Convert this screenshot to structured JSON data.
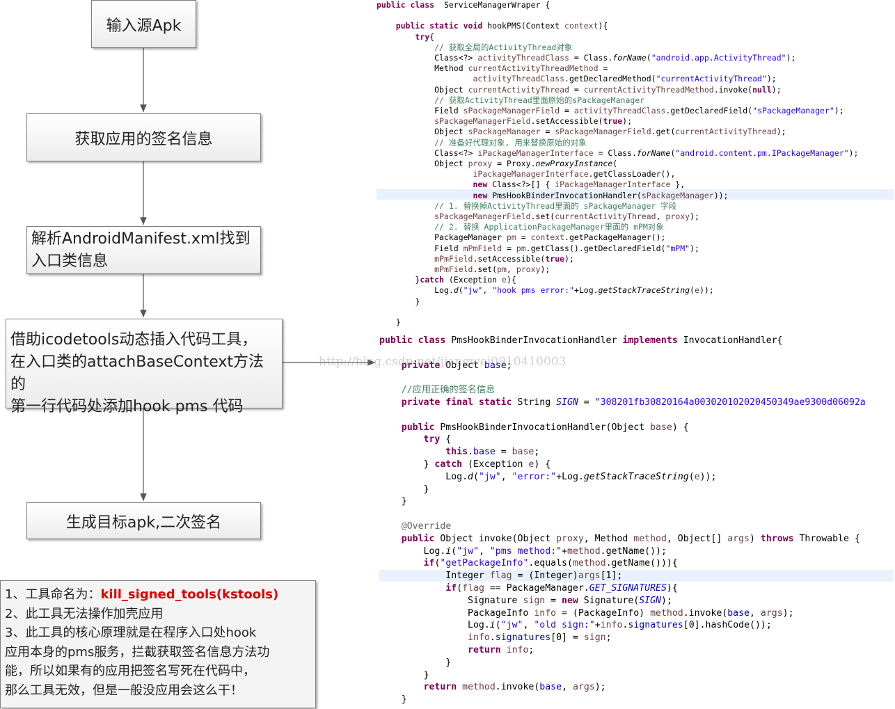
{
  "flow": {
    "step1": "输入源Apk",
    "step2": "获取应用的签名信息",
    "step3": [
      "解析AndroidManifest.xml找到",
      "入口类信息"
    ],
    "step4": [
      "借助icodetools动态插入代码工具，",
      "在入口类的attachBaseContext方法的",
      "第一行代码处添加hook pms 代码"
    ],
    "step5": "生成目标apk,二次签名"
  },
  "notes": {
    "line1_prefix": "1、工具命名为：",
    "line1_name": "kill_signed_tools(kstools)",
    "line2": "2、此工具无法操作加壳应用",
    "line3": "3、此工具的核心原理就是在程序入口处hook",
    "line4": "应用本身的pms服务，拦截获取签名信息方法功",
    "line5": "能，所以如果有的应用把签名写死在代码中，",
    "line6": "那么工具无效，但是一般没应用会这么干！"
  },
  "watermark": "http://blog.csdn.net/jiangwei0910410003",
  "code1": [
    [
      [
        "kw",
        "public class"
      ],
      [
        "",
        "  ServiceManagerWraper {"
      ]
    ],
    [],
    [
      [
        "",
        "    "
      ],
      [
        "kw",
        "public static void"
      ],
      [
        "",
        " hookPMS(Context "
      ],
      [
        "var",
        "context"
      ],
      [
        "",
        "){"
      ]
    ],
    [
      [
        "",
        "        "
      ],
      [
        "kw",
        "try"
      ],
      [
        "",
        "{"
      ]
    ],
    [
      [
        "",
        "            "
      ],
      [
        "cm",
        "// 获取全局的ActivityThread对象"
      ]
    ],
    [
      [
        "",
        "            Class<?> "
      ],
      [
        "var",
        "activityThreadClass"
      ],
      [
        "",
        " = Class."
      ],
      [
        "it",
        "forName"
      ],
      [
        "",
        "("
      ],
      [
        "str",
        "\"android.app.ActivityThread\""
      ],
      [
        "",
        ");"
      ]
    ],
    [
      [
        "",
        "            Method "
      ],
      [
        "var",
        "currentActivityThreadMethod"
      ],
      [
        "",
        " ="
      ]
    ],
    [
      [
        "",
        "                    "
      ],
      [
        "var",
        "activityThreadClass"
      ],
      [
        "",
        ".getDeclaredMethod("
      ],
      [
        "str",
        "\"currentActivityThread\""
      ],
      [
        "",
        ");"
      ]
    ],
    [
      [
        "",
        "            Object "
      ],
      [
        "var",
        "currentActivityThread"
      ],
      [
        "",
        " = "
      ],
      [
        "var",
        "currentActivityThreadMethod"
      ],
      [
        "",
        ".invoke("
      ],
      [
        "kw",
        "null"
      ],
      [
        "",
        ");"
      ]
    ],
    [
      [
        "",
        "            "
      ],
      [
        "cm",
        "// 获取ActivityThread里面原始的sPackageManager"
      ]
    ],
    [
      [
        "",
        "            Field "
      ],
      [
        "var",
        "sPackageManagerField"
      ],
      [
        "",
        " = "
      ],
      [
        "var",
        "activityThreadClass"
      ],
      [
        "",
        ".getDeclaredField("
      ],
      [
        "str",
        "\"sPackageManager\""
      ],
      [
        "",
        ");"
      ]
    ],
    [
      [
        "",
        "            "
      ],
      [
        "var",
        "sPackageManagerField"
      ],
      [
        "",
        ".setAccessible("
      ],
      [
        "kw",
        "true"
      ],
      [
        "",
        ");"
      ]
    ],
    [
      [
        "",
        "            Object "
      ],
      [
        "var",
        "sPackageManager"
      ],
      [
        "",
        " = "
      ],
      [
        "var",
        "sPackageManagerField"
      ],
      [
        "",
        ".get("
      ],
      [
        "var",
        "currentActivityThread"
      ],
      [
        "",
        ");"
      ]
    ],
    [
      [
        "",
        "            "
      ],
      [
        "cm",
        "// 准备好代理对象, 用来替换原始的对象"
      ]
    ],
    [
      [
        "",
        "            Class<?> "
      ],
      [
        "var",
        "iPackageManagerInterface"
      ],
      [
        "",
        " = Class."
      ],
      [
        "it",
        "forName"
      ],
      [
        "",
        "("
      ],
      [
        "str",
        "\"android.content.pm.IPackageManager\""
      ],
      [
        "",
        ");"
      ]
    ],
    [
      [
        "",
        "            Object "
      ],
      [
        "var",
        "proxy"
      ],
      [
        "",
        " = Proxy."
      ],
      [
        "it",
        "newProxyInstance"
      ],
      [
        "",
        "("
      ]
    ],
    [
      [
        "",
        "                    "
      ],
      [
        "var",
        "iPackageManagerInterface"
      ],
      [
        "",
        ".getClassLoader(),"
      ]
    ],
    [
      [
        "",
        "                    "
      ],
      [
        "kw",
        "new"
      ],
      [
        "",
        " Class<?>[] { "
      ],
      [
        "var",
        "iPackageManagerInterface"
      ],
      [
        "",
        " },"
      ]
    ],
    [
      [
        "",
        "                    "
      ],
      [
        "kw",
        "new"
      ],
      [
        "",
        " PmsHookBinderInvocationHandler("
      ],
      [
        "var",
        "sPackageManager"
      ],
      [
        "",
        "));"
      ]
    ],
    [
      [
        "",
        "            "
      ],
      [
        "cm",
        "// 1. 替换掉ActivityThread里面的 sPackageManager 字段"
      ]
    ],
    [
      [
        "",
        "            "
      ],
      [
        "var",
        "sPackageManagerField"
      ],
      [
        "",
        ".set("
      ],
      [
        "var",
        "currentActivityThread"
      ],
      [
        "",
        ", "
      ],
      [
        "var",
        "proxy"
      ],
      [
        "",
        ");"
      ]
    ],
    [
      [
        "",
        "            "
      ],
      [
        "cm",
        "// 2. 替换 ApplicationPackageManager里面的 mPM对象"
      ]
    ],
    [
      [
        "",
        "            PackageManager "
      ],
      [
        "var",
        "pm"
      ],
      [
        "",
        " = "
      ],
      [
        "var",
        "context"
      ],
      [
        "",
        ".getPackageManager();"
      ]
    ],
    [
      [
        "",
        "            Field "
      ],
      [
        "var",
        "mPmField"
      ],
      [
        "",
        " = "
      ],
      [
        "var",
        "pm"
      ],
      [
        "",
        ".getClass().getDeclaredField("
      ],
      [
        "str",
        "\"mPM\""
      ],
      [
        "",
        ");"
      ]
    ],
    [
      [
        "",
        "            "
      ],
      [
        "var",
        "mPmField"
      ],
      [
        "",
        ".setAccessible("
      ],
      [
        "kw",
        "true"
      ],
      [
        "",
        ");"
      ]
    ],
    [
      [
        "",
        "            "
      ],
      [
        "var",
        "mPmField"
      ],
      [
        "",
        ".set("
      ],
      [
        "var",
        "pm"
      ],
      [
        "",
        ", "
      ],
      [
        "var",
        "proxy"
      ],
      [
        "",
        ");"
      ]
    ],
    [
      [
        "",
        "        }"
      ],
      [
        "kw",
        "catch"
      ],
      [
        "",
        " (Exception "
      ],
      [
        "var",
        "e"
      ],
      [
        "",
        "){"
      ]
    ],
    [
      [
        "",
        "            Log."
      ],
      [
        "it",
        "d"
      ],
      [
        "",
        "("
      ],
      [
        "str",
        "\"jw\""
      ],
      [
        "",
        ", "
      ],
      [
        "str",
        "\"hook pms error:\""
      ],
      [
        "",
        "+Log."
      ],
      [
        "it",
        "getStackTraceString"
      ],
      [
        "",
        "("
      ],
      [
        "var",
        "e"
      ],
      [
        "",
        "));"
      ]
    ],
    [
      [
        "",
        "        }"
      ]
    ],
    [],
    [
      [
        "",
        "    }"
      ]
    ]
  ],
  "code2": [
    [
      [
        "kw",
        "public class"
      ],
      [
        "",
        " PmsHookBinderInvocationHandler "
      ],
      [
        "kw",
        "implements"
      ],
      [
        "",
        " InvocationHandler{"
      ]
    ],
    [],
    [
      [
        "",
        "    "
      ],
      [
        "kw",
        "private"
      ],
      [
        "",
        " Object "
      ],
      [
        "fld",
        "base"
      ],
      [
        "",
        ";"
      ]
    ],
    [],
    [
      [
        "",
        "    "
      ],
      [
        "cm",
        "//应用正确的签名信息"
      ]
    ],
    [
      [
        "",
        "    "
      ],
      [
        "kw",
        "private final static"
      ],
      [
        "",
        " String "
      ],
      [
        "fld it",
        "SIGN"
      ],
      [
        "",
        " = "
      ],
      [
        "str",
        "\"308201fb30820164a003020102020450349ae9300d06092a"
      ]
    ],
    [],
    [
      [
        "",
        "    "
      ],
      [
        "kw",
        "public"
      ],
      [
        "",
        " PmsHookBinderInvocationHandler(Object "
      ],
      [
        "var",
        "base"
      ],
      [
        "",
        ") {"
      ]
    ],
    [
      [
        "",
        "        "
      ],
      [
        "kw",
        "try"
      ],
      [
        "",
        " {"
      ]
    ],
    [
      [
        "",
        "            "
      ],
      [
        "kw",
        "this"
      ],
      [
        "",
        "."
      ],
      [
        "fld",
        "base"
      ],
      [
        "",
        " = "
      ],
      [
        "var",
        "base"
      ],
      [
        "",
        ";"
      ]
    ],
    [
      [
        "",
        "        } "
      ],
      [
        "kw",
        "catch"
      ],
      [
        "",
        " (Exception "
      ],
      [
        "var",
        "e"
      ],
      [
        "",
        ") {"
      ]
    ],
    [
      [
        "",
        "            Log."
      ],
      [
        "it",
        "d"
      ],
      [
        "",
        "("
      ],
      [
        "str",
        "\"jw\""
      ],
      [
        "",
        ", "
      ],
      [
        "str",
        "\"error:\""
      ],
      [
        "",
        "+Log."
      ],
      [
        "it",
        "getStackTraceString"
      ],
      [
        "",
        "("
      ],
      [
        "var",
        "e"
      ],
      [
        "",
        "));"
      ]
    ],
    [
      [
        "",
        "        }"
      ]
    ],
    [
      [
        "",
        "    }"
      ]
    ],
    [],
    [
      [
        "",
        "    "
      ],
      [
        "ann",
        "@Override"
      ]
    ],
    [
      [
        "",
        "    "
      ],
      [
        "kw",
        "public"
      ],
      [
        "",
        " Object invoke(Object "
      ],
      [
        "var",
        "proxy"
      ],
      [
        "",
        ", Method "
      ],
      [
        "var",
        "method"
      ],
      [
        "",
        ", Object[] "
      ],
      [
        "var",
        "args"
      ],
      [
        "",
        ") "
      ],
      [
        "kw",
        "throws"
      ],
      [
        "",
        " Throwable {"
      ]
    ],
    [
      [
        "",
        "        Log."
      ],
      [
        "it",
        "i"
      ],
      [
        "",
        "("
      ],
      [
        "str",
        "\"jw\""
      ],
      [
        "",
        ", "
      ],
      [
        "str",
        "\"pms method:\""
      ],
      [
        "",
        "+"
      ],
      [
        "var",
        "method"
      ],
      [
        "",
        ".getName());"
      ]
    ],
    [
      [
        "",
        "        "
      ],
      [
        "kw",
        "if"
      ],
      [
        "",
        "("
      ],
      [
        "str",
        "\"getPackageInfo\""
      ],
      [
        "",
        ".equals("
      ],
      [
        "var",
        "method"
      ],
      [
        "",
        ".getName())){"
      ]
    ],
    [
      [
        "",
        "            Integer "
      ],
      [
        "var",
        "flag"
      ],
      [
        "",
        " = (Integer)"
      ],
      [
        "var",
        "args"
      ],
      [
        "",
        "[1];"
      ]
    ],
    [
      [
        "",
        "            "
      ],
      [
        "kw",
        "if"
      ],
      [
        "",
        "("
      ],
      [
        "var",
        "flag"
      ],
      [
        "",
        " == PackageManager."
      ],
      [
        "fld it",
        "GET_SIGNATURES"
      ],
      [
        "",
        "){"
      ]
    ],
    [
      [
        "",
        "                Signature "
      ],
      [
        "var",
        "sign"
      ],
      [
        "",
        " = "
      ],
      [
        "kw",
        "new"
      ],
      [
        "",
        " Signature("
      ],
      [
        "fld it",
        "SIGN"
      ],
      [
        "",
        ");"
      ]
    ],
    [
      [
        "",
        "                PackageInfo "
      ],
      [
        "var",
        "info"
      ],
      [
        "",
        " = (PackageInfo) "
      ],
      [
        "var",
        "method"
      ],
      [
        "",
        ".invoke("
      ],
      [
        "fld",
        "base"
      ],
      [
        "",
        ", "
      ],
      [
        "var",
        "args"
      ],
      [
        "",
        ");"
      ]
    ],
    [
      [
        "",
        "                Log."
      ],
      [
        "it",
        "i"
      ],
      [
        "",
        "("
      ],
      [
        "str",
        "\"jw\""
      ],
      [
        "",
        ", "
      ],
      [
        "str",
        "\"old sign:\""
      ],
      [
        "",
        "+"
      ],
      [
        "var",
        "info"
      ],
      [
        "",
        "."
      ],
      [
        "fld",
        "signatures"
      ],
      [
        "",
        "[0].hashCode());"
      ]
    ],
    [
      [
        "",
        "                "
      ],
      [
        "var",
        "info"
      ],
      [
        "",
        "."
      ],
      [
        "fld",
        "signatures"
      ],
      [
        "",
        "[0] = "
      ],
      [
        "var",
        "sign"
      ],
      [
        "",
        ";"
      ]
    ],
    [
      [
        "",
        "                "
      ],
      [
        "kw",
        "return"
      ],
      [
        "",
        " "
      ],
      [
        "var",
        "info"
      ],
      [
        "",
        ";"
      ]
    ],
    [
      [
        "",
        "            }"
      ]
    ],
    [
      [
        "",
        "        }"
      ]
    ],
    [
      [
        "",
        "        "
      ],
      [
        "kw",
        "return"
      ],
      [
        "",
        " "
      ],
      [
        "var",
        "method"
      ],
      [
        "",
        ".invoke("
      ],
      [
        "fld",
        "base"
      ],
      [
        "",
        ", "
      ],
      [
        "var",
        "args"
      ],
      [
        "",
        ");"
      ]
    ],
    [
      [
        "",
        "    }"
      ]
    ]
  ]
}
